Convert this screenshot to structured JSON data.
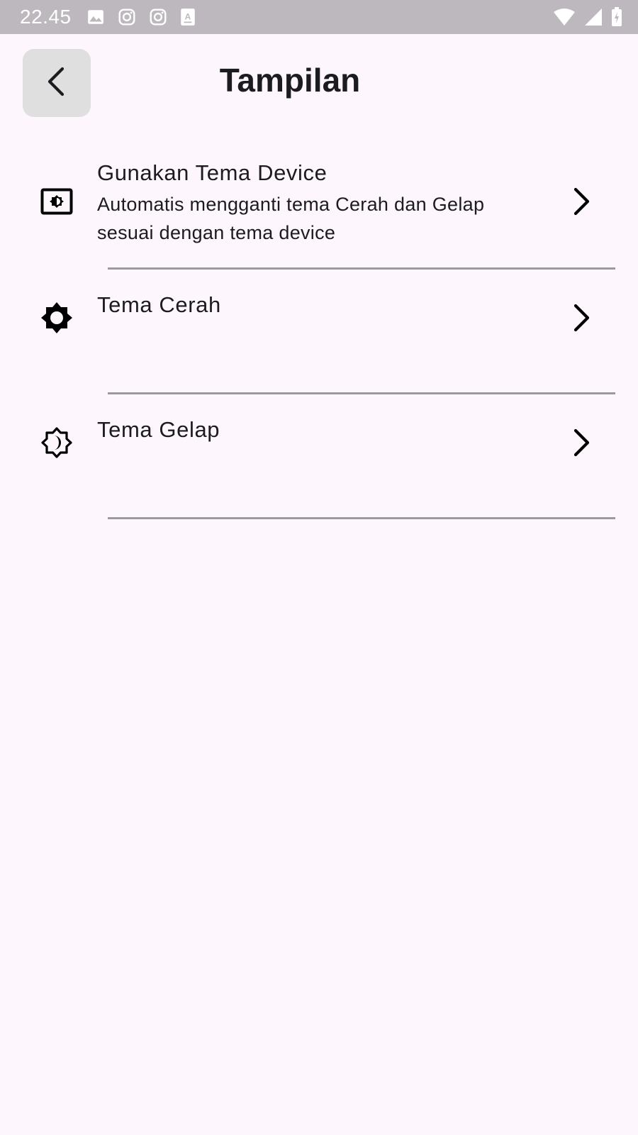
{
  "status_bar": {
    "time": "22.45",
    "left_icons": [
      "image-icon",
      "instagram-icon",
      "instagram-icon",
      "text-notification-icon"
    ],
    "right_icons": [
      "wifi-icon",
      "signal-icon",
      "battery-charging-icon"
    ],
    "background": "#BDB8BD"
  },
  "header": {
    "title": "Tampilan",
    "back_icon": "chevron-left-icon"
  },
  "settings": {
    "items": [
      {
        "title": "Gunakan Tema Device",
        "subtitle": "Automatis mengganti tema Cerah dan Gelap sesuai dengan tema device",
        "icon": "brightness-auto-icon"
      },
      {
        "title": "Tema Cerah",
        "subtitle": "",
        "icon": "brightness-high-icon"
      },
      {
        "title": "Tema Gelap",
        "subtitle": "",
        "icon": "brightness-dark-icon"
      }
    ]
  },
  "colors": {
    "background": "#FDF7FD",
    "back_button_bg": "#DFDFDF",
    "divider": "#9A9A9A",
    "text": "#1C1B1F"
  }
}
